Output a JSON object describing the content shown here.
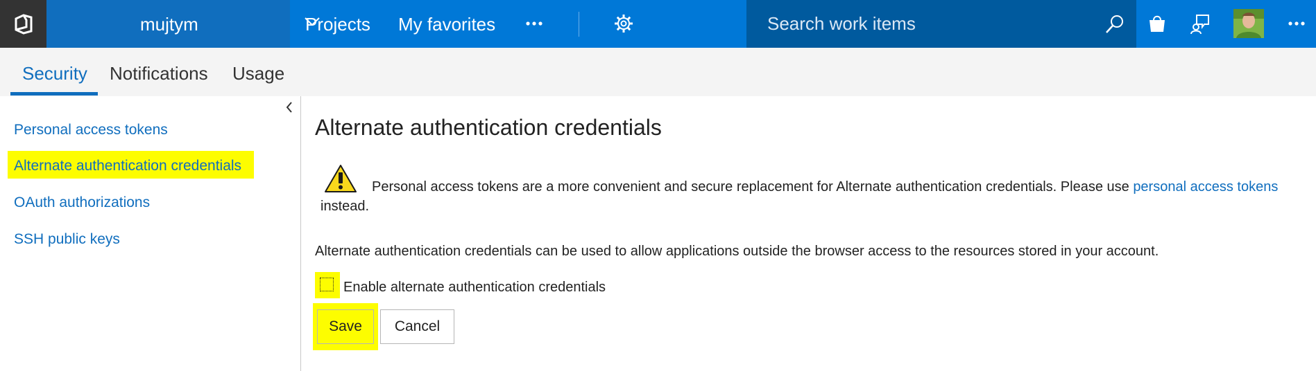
{
  "topbar": {
    "account_name": "mujtym",
    "nav": [
      "Projects",
      "My favorites"
    ],
    "search_placeholder": "Search work items"
  },
  "tabs": [
    {
      "label": "Security",
      "active": true
    },
    {
      "label": "Notifications",
      "active": false
    },
    {
      "label": "Usage",
      "active": false
    }
  ],
  "sidebar": {
    "items": [
      {
        "label": "Personal access tokens",
        "highlighted": false
      },
      {
        "label": "Alternate authentication credentials",
        "highlighted": true
      },
      {
        "label": "OAuth authorizations",
        "highlighted": false
      },
      {
        "label": "SSH public keys",
        "highlighted": false
      }
    ]
  },
  "main": {
    "title": "Alternate authentication credentials",
    "warning": {
      "text_before": "Personal access tokens are a more convenient and secure replacement for Alternate authentication credentials. Please use ",
      "link": "personal access tokens",
      "text_after": " instead."
    },
    "description": "Alternate authentication credentials can be used to allow applications outside the browser access to the resources stored in your account.",
    "checkbox": {
      "label": "Enable alternate authentication credentials",
      "checked": false
    },
    "save_label": "Save",
    "cancel_label": "Cancel"
  },
  "colors": {
    "brand_blue": "#0078d7",
    "account_blue": "#106ebe",
    "search_blue": "#005a9e",
    "highlight_yellow": "#fdfd00",
    "link_blue": "#106ebe"
  },
  "icons": [
    "vsts-logo-icon",
    "chevron-down-icon",
    "more-icon",
    "gear-icon",
    "search-icon",
    "shopping-bag-icon",
    "feedback-icon",
    "more-icon",
    "collapse-chevron-icon",
    "warning-icon"
  ]
}
